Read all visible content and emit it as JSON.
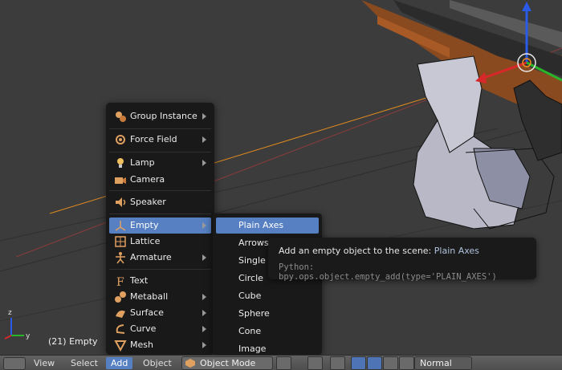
{
  "viewport": {
    "object_label": "(21) Empty"
  },
  "add_menu": {
    "items": [
      {
        "label": "Group Instance",
        "icon": "group-instance-icon",
        "submenu": true
      },
      {
        "label": "Force Field",
        "icon": "force-field-icon",
        "submenu": true
      },
      {
        "label": "Lamp",
        "icon": "lamp-icon",
        "submenu": true
      },
      {
        "label": "Camera",
        "icon": "camera-icon",
        "submenu": false
      },
      {
        "label": "Speaker",
        "icon": "speaker-icon",
        "submenu": false
      },
      {
        "label": "Empty",
        "icon": "empty-icon",
        "submenu": true,
        "active": true
      },
      {
        "label": "Lattice",
        "icon": "lattice-icon",
        "submenu": false
      },
      {
        "label": "Armature",
        "icon": "armature-icon",
        "submenu": true
      },
      {
        "label": "Text",
        "icon": "text-icon",
        "submenu": false
      },
      {
        "label": "Metaball",
        "icon": "metaball-icon",
        "submenu": true
      },
      {
        "label": "Surface",
        "icon": "surface-icon",
        "submenu": true
      },
      {
        "label": "Curve",
        "icon": "curve-icon",
        "submenu": true
      },
      {
        "label": "Mesh",
        "icon": "mesh-icon",
        "submenu": true
      }
    ]
  },
  "empty_submenu": {
    "items": [
      "Plain Axes",
      "Arrows",
      "Single Arrow",
      "Circle",
      "Cube",
      "Sphere",
      "Cone",
      "Image"
    ],
    "active": "Plain Axes"
  },
  "tooltip": {
    "prefix": "Add an empty object to the scene:",
    "value": "Plain Axes",
    "python": "Python: bpy.ops.object.empty_add(type='PLAIN_AXES')"
  },
  "header": {
    "menus": [
      "View",
      "Select",
      "Add",
      "Object"
    ],
    "active_menu": "Add",
    "mode": "Object Mode",
    "orientation": "Normal"
  },
  "colors": {
    "accent": "#5680c2",
    "menu_bg": "#191919",
    "header_bg": "#555555",
    "viewport_bg": "#3c3c3c"
  }
}
